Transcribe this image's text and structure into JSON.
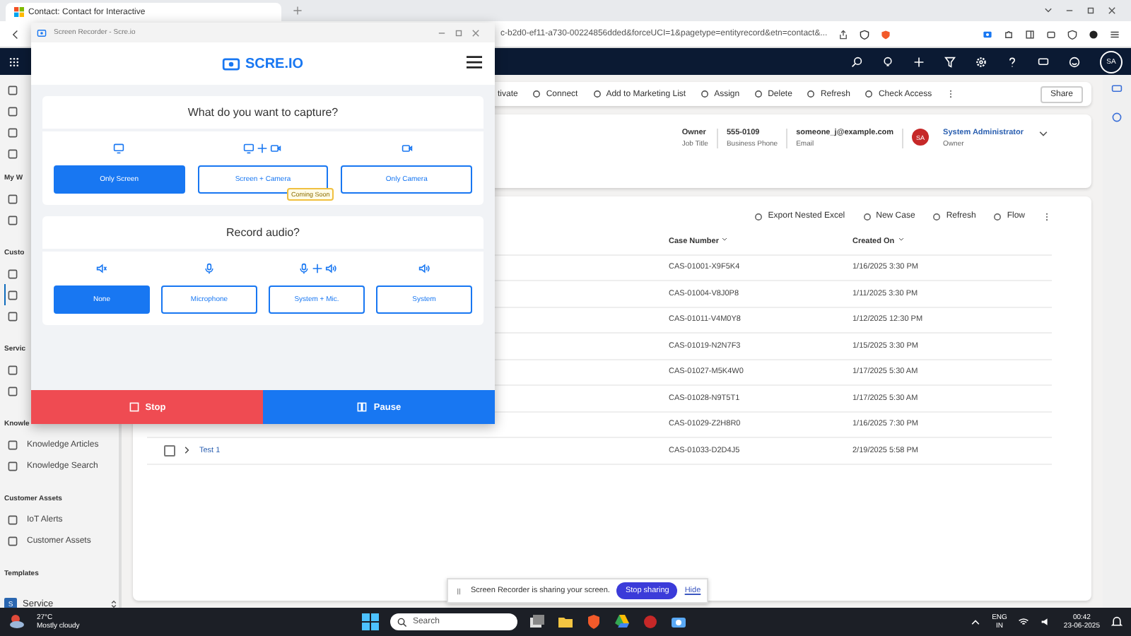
{
  "browser": {
    "tab_title": "Contact: Contact for Interactive",
    "url": "c-b2d0-ef11-a730-00224856dded&forceUCI=1&pagetype=entityrecord&etn=contact&..."
  },
  "nav": {
    "avatar": "SA"
  },
  "sidebar": {
    "sections": [
      {
        "items": [
          {
            "kind": "icon",
            "selected": false
          },
          {
            "kind": "icon",
            "selected": false
          },
          {
            "kind": "icon",
            "selected": false
          },
          {
            "kind": "icon",
            "selected": false
          }
        ]
      },
      {
        "heading": "My W",
        "items": [
          {
            "kind": "icon",
            "selected": false
          },
          {
            "kind": "icon",
            "selected": false
          }
        ]
      },
      {
        "heading": "Custo",
        "items": [
          {
            "kind": "icon",
            "selected": false
          },
          {
            "kind": "icon",
            "selected": true
          },
          {
            "kind": "icon",
            "selected": false
          }
        ]
      },
      {
        "heading": "Servic",
        "items": [
          {
            "kind": "icon",
            "selected": false
          },
          {
            "kind": "icon",
            "selected": false
          }
        ]
      },
      {
        "heading": "Knowle",
        "items": [
          {
            "kind": "link",
            "label": "Knowledge Articles",
            "selected": false
          },
          {
            "kind": "link",
            "label": "Knowledge Search",
            "selected": false
          }
        ]
      },
      {
        "heading": "Customer Assets",
        "items": [
          {
            "kind": "link",
            "label": "IoT Alerts",
            "selected": false
          },
          {
            "kind": "link",
            "label": "Customer Assets",
            "selected": false
          }
        ]
      },
      {
        "heading": "Templates"
      }
    ],
    "area": {
      "badge": "S",
      "label": "Service"
    }
  },
  "command_bar": {
    "items": [
      "tivate",
      "Connect",
      "Add to Marketing List",
      "Assign",
      "Delete",
      "Refresh",
      "Check Access"
    ],
    "share": "Share"
  },
  "header_fields": [
    {
      "value": "Owner",
      "label": "Job Title"
    },
    {
      "value": "555-0109",
      "label": "Business Phone"
    },
    {
      "value": "someone_j@example.com",
      "label": "Email"
    }
  ],
  "owner": {
    "initials": "SA",
    "name": "System Administrator",
    "label": "Owner"
  },
  "subgrid": {
    "toolbar": [
      "Export Nested Excel",
      "New Case",
      "Refresh",
      "Flow"
    ],
    "columns": [
      "Case Number",
      "Created On"
    ],
    "rows": [
      {
        "case_number": "CAS-01001-X9F5K4",
        "created_on": "1/16/2025 3:30 PM"
      },
      {
        "case_number": "CAS-01004-V8J0P8",
        "created_on": "1/11/2025 3:30 PM"
      },
      {
        "case_number": "CAS-01011-V4M0Y8",
        "created_on": "1/12/2025 12:30 PM"
      },
      {
        "case_number": "CAS-01019-N2N7F3",
        "created_on": "1/15/2025 3:30 PM"
      },
      {
        "case_number": "CAS-01027-M5K4W0",
        "created_on": "1/17/2025 5:30 AM"
      },
      {
        "case_number": "CAS-01028-N9T5T1",
        "created_on": "1/17/2025 5:30 AM"
      },
      {
        "case_number": "CAS-01029-Z2H8R0",
        "created_on": "1/16/2025 7:30 PM"
      },
      {
        "title": "Test 1",
        "checked": false,
        "case_number": "CAS-01033-D2D4J5",
        "created_on": "2/19/2025 5:58 PM"
      }
    ]
  },
  "recorder": {
    "window_title": "Screen Recorder - Scre.io",
    "logo": "SCRE.IO",
    "capture": {
      "question": "What do you want to capture?",
      "options": [
        {
          "label": "Only Screen",
          "kind": "screen",
          "selected": true
        },
        {
          "label": "Screen + Camera",
          "kind": "screen_camera",
          "selected": false,
          "badge": "Coming Soon"
        },
        {
          "label": "Only Camera",
          "kind": "camera",
          "selected": false
        }
      ]
    },
    "audio": {
      "question": "Record audio?",
      "options": [
        {
          "label": "None",
          "kind": "mute",
          "selected": true
        },
        {
          "label": "Microphone",
          "kind": "mic",
          "selected": false
        },
        {
          "label": "System + Mic.",
          "kind": "mic_system",
          "selected": false
        },
        {
          "label": "System",
          "kind": "system",
          "selected": false
        }
      ]
    },
    "stop": "Stop",
    "pause": "Pause"
  },
  "sharing": {
    "message": "Screen Recorder is sharing your screen.",
    "stop": "Stop sharing",
    "hide": "Hide"
  },
  "taskbar": {
    "temp": "27°C",
    "weather": "Mostly cloudy",
    "search": "Search",
    "lang": "ENG",
    "region": "IN",
    "time": "00:42",
    "date": "23-06-2025"
  }
}
